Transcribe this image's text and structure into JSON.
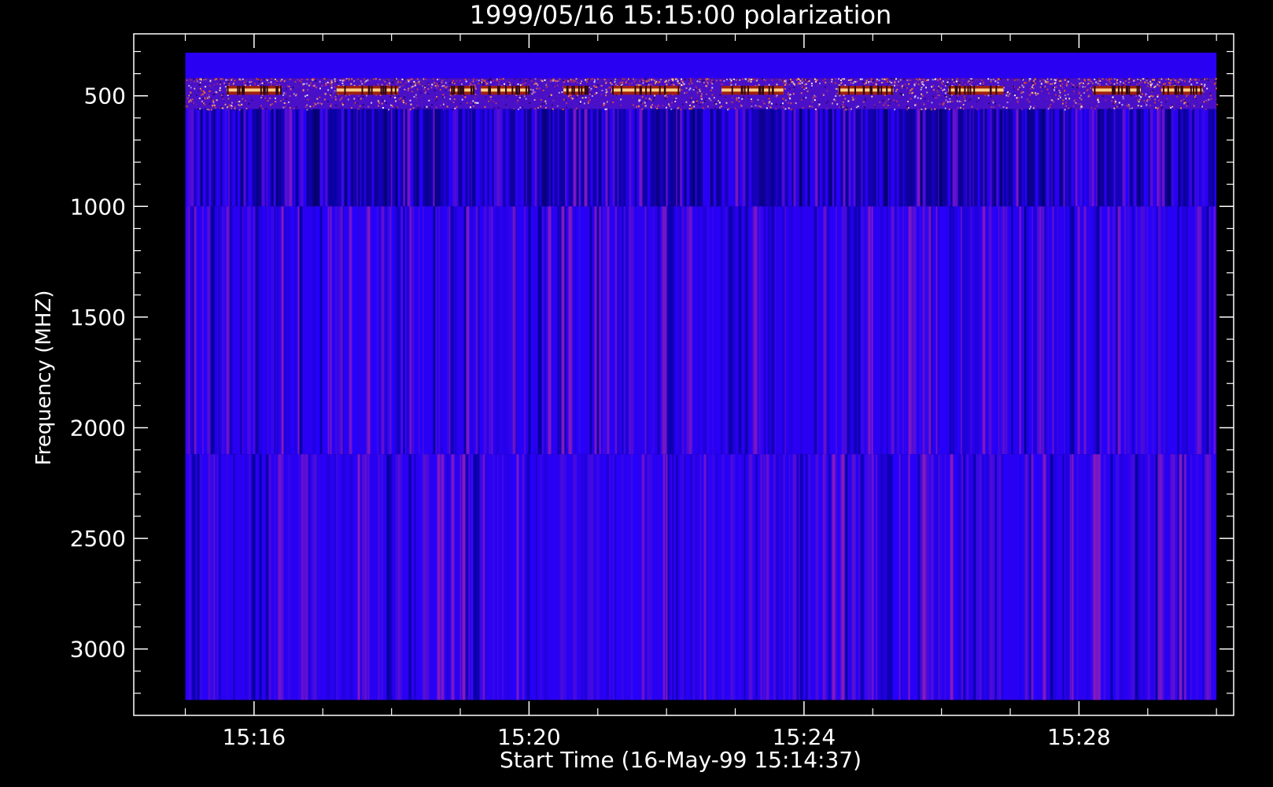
{
  "chart_data": {
    "type": "heatmap",
    "title": "1999/05/16 15:15:00 polarization",
    "xlabel": "Start Time (16-May-99 15:14:37)",
    "ylabel": "Frequency (MHZ)",
    "x_ticks": [
      {
        "minutes": 16,
        "label": "15:16"
      },
      {
        "minutes": 20,
        "label": "15:20"
      },
      {
        "minutes": 24,
        "label": "15:24"
      },
      {
        "minutes": 28,
        "label": "15:28"
      }
    ],
    "y_ticks": [
      500,
      1000,
      1500,
      2000,
      2500,
      3000
    ],
    "xlim_minutes_after_1500": [
      14.25,
      30.25
    ],
    "ylim_mhz": [
      3300,
      220
    ],
    "y_reversed": true,
    "data_x_range_minutes_after_1500": [
      15,
      30
    ],
    "data_y_range_mhz": [
      3230,
      305
    ],
    "bands_mhz": [
      {
        "from": 305,
        "to": 420,
        "description": "uniform"
      },
      {
        "from": 420,
        "to": 560,
        "description": "noisy-bursts"
      },
      {
        "from": 560,
        "to": 1000,
        "description": "dark-striped"
      },
      {
        "from": 1000,
        "to": 2120,
        "description": "striped"
      },
      {
        "from": 2120,
        "to": 3230,
        "description": "striped"
      }
    ],
    "burst_intervals_minutes_after_1500": [
      [
        15.6,
        16.4
      ],
      [
        17.2,
        18.1
      ],
      [
        18.85,
        19.2
      ],
      [
        19.3,
        20.0
      ],
      [
        20.5,
        20.85
      ],
      [
        21.2,
        22.2
      ],
      [
        22.8,
        23.7
      ],
      [
        24.5,
        25.3
      ],
      [
        26.1,
        26.9
      ],
      [
        28.2,
        28.9
      ],
      [
        29.2,
        29.8
      ]
    ],
    "colors": {
      "background": "#000000",
      "base": "#2a00f2",
      "dark": "#05009a",
      "warm": "#8a1bbb",
      "hot": "#ffd080",
      "axis": "#ffffff"
    },
    "grid": false,
    "legend": "none"
  }
}
